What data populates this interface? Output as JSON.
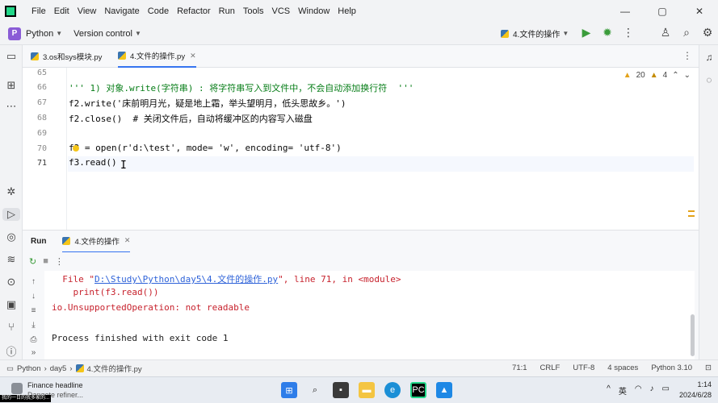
{
  "menu": [
    "File",
    "Edit",
    "View",
    "Navigate",
    "Code",
    "Refactor",
    "Run",
    "Tools",
    "VCS",
    "Window",
    "Help"
  ],
  "window_controls": [
    "—",
    "▢",
    "✕"
  ],
  "toolbar": {
    "project_badge": "P",
    "project_name": "Python",
    "vcs_label": "Version control",
    "run_config": "4.文件的操作"
  },
  "tabs": [
    {
      "label": "3.os和sys模块.py",
      "active": false
    },
    {
      "label": "4.文件的操作.py",
      "active": true
    }
  ],
  "inspections": {
    "warnings": "20",
    "weak_warnings": "4"
  },
  "editor": {
    "line_numbers": [
      "65",
      "66",
      "67",
      "68",
      "69",
      "70",
      "71"
    ],
    "current_line": "71",
    "lines": [
      "",
      "''' 1) 对象.write(字符串) : 将字符串写入到文件中，不会自动添加换行符  '''",
      "f2.write('床前明月光，疑是地上霜，举头望明月，低头思故乡。')",
      "f2.close()  # 关闭文件后，自动将缓冲区的内容写入磁盘",
      "",
      "f3 = open(r'd:\\test', mode= 'w', encoding= 'utf-8')",
      "f3.read()"
    ]
  },
  "run_panel": {
    "label": "Run",
    "tab": "4.文件的操作",
    "console": {
      "file_prefix": "  File \"",
      "file_link": "D:\\Study\\Python\\day5\\4.文件的操作.py",
      "file_suffix": "\", line 71, in <module>",
      "code_line": "    print(f3.read())",
      "error": "io.UnsupportedOperation: not readable",
      "finished": "Process finished with exit code 1"
    }
  },
  "statusbar": {
    "breadcrumb": [
      "Python",
      "day5",
      "4.文件的操作.py"
    ],
    "position": "71:1",
    "line_sep": "CRLF",
    "encoding": "UTF-8",
    "indent": "4 spaces",
    "interpreter": "Python 3.10"
  },
  "taskbar": {
    "news_title": "Finance headline",
    "news_sub": "Dangote refiner...",
    "ime": "英",
    "time": "1:14",
    "date": "2024/6/28"
  },
  "watermark": "我的一日的我多家的...",
  "colors": {
    "accent": "#3574f0",
    "error": "#c7222d",
    "string": "#067d17",
    "comment": "#8c8c8c"
  }
}
